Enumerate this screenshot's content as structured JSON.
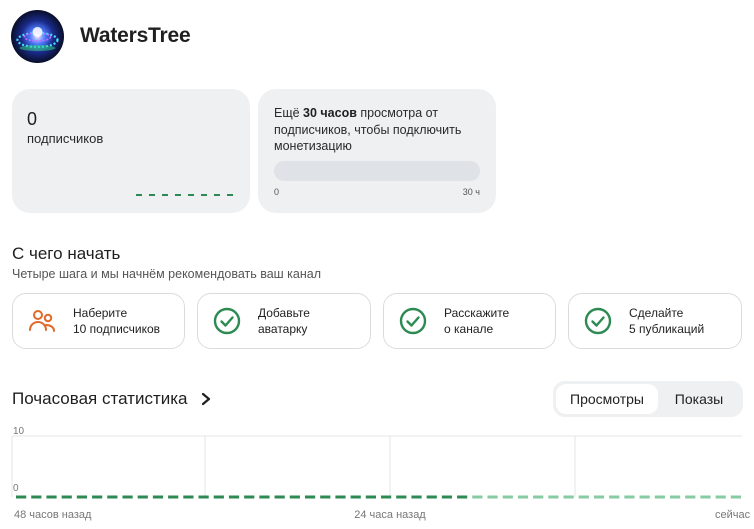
{
  "channel": {
    "name": "WatersTree",
    "avatar_icon": "led-fountain-avatar"
  },
  "subscribers": {
    "count": "0",
    "label": "подписчиков"
  },
  "monetization": {
    "prefix": "Ещё ",
    "bold": "30 часов",
    "suffix": " просмотра от подписчиков, чтобы подключить монетизацию",
    "progress_fraction": 0,
    "min_label": "0",
    "max_label": "30 ч"
  },
  "onboarding": {
    "title": "С чего начать",
    "subtitle": "Четыре шага и мы начнём рекомендовать ваш канал",
    "steps": [
      {
        "line1": "Наберите",
        "line2": "10 подписчиков",
        "icon": "users-icon",
        "done": false
      },
      {
        "line1": "Добавьте",
        "line2": "аватарку",
        "icon": "check-circle-icon",
        "done": true
      },
      {
        "line1": "Расскажите",
        "line2": "о канале",
        "icon": "check-circle-icon",
        "done": true
      },
      {
        "line1": "Сделайте",
        "line2": "5 публикаций",
        "icon": "check-circle-icon",
        "done": true
      }
    ]
  },
  "stats": {
    "title": "Почасовая статистика",
    "tabs": [
      "Просмотры",
      "Показы"
    ],
    "active_tab": "Просмотры"
  },
  "colors": {
    "accent_green": "#2d8a52",
    "accent_orange": "#e06a2a",
    "card_bg": "#eef0f2"
  },
  "chart_data": {
    "type": "line",
    "y_ticks": [
      "10",
      "0"
    ],
    "ylim": [
      0,
      10
    ],
    "x_tick_labels": [
      "48 часов назад",
      "24 часа назад",
      "сейчас"
    ],
    "series": [
      {
        "values": [
          0,
          0,
          0,
          0,
          0,
          0,
          0,
          0,
          0,
          0,
          0,
          0,
          0,
          0,
          0,
          0,
          0,
          0,
          0,
          0,
          0,
          0,
          0,
          0,
          0,
          0,
          0,
          0,
          0,
          0,
          0,
          0,
          0,
          0,
          0,
          0,
          0,
          0,
          0,
          0,
          0,
          0,
          0,
          0,
          0,
          0,
          0,
          0
        ]
      }
    ]
  }
}
